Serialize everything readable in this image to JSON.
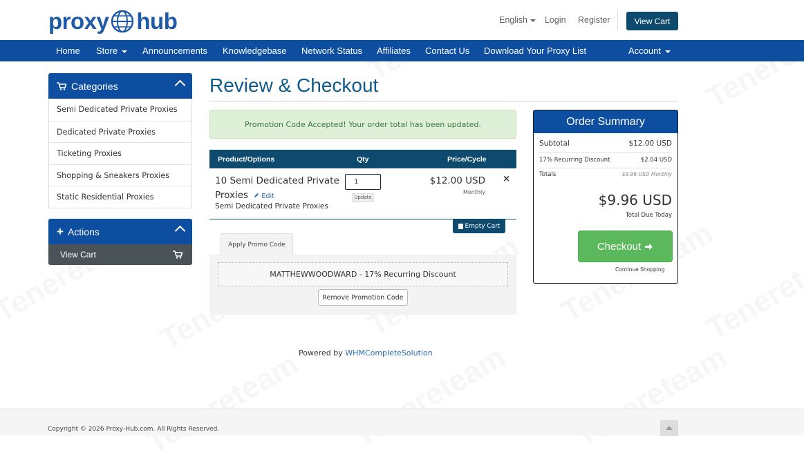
{
  "brand": {
    "logo_left": "proxy",
    "logo_right": "hub"
  },
  "top_links": {
    "language": "English",
    "login": "Login",
    "register": "Register",
    "view_cart": "View Cart"
  },
  "nav": {
    "home": "Home",
    "store": "Store",
    "announcements": "Announcements",
    "knowledgebase": "Knowledgebase",
    "network_status": "Network Status",
    "affiliates": "Affiliates",
    "contact_us": "Contact Us",
    "download": "Download Your Proxy List",
    "account": "Account"
  },
  "sidebar": {
    "categories_title": "Categories",
    "categories": [
      "Semi Dedicated Private Proxies",
      "Dedicated Private Proxies",
      "Ticketing Proxies",
      "Shopping & Sneakers Proxies",
      "Static Residential Proxies"
    ],
    "actions_title": "Actions",
    "actions_view_cart": "View Cart"
  },
  "main": {
    "title": "Review & Checkout",
    "alert": "Promotion Code Accepted! Your order total has been updated.",
    "table_headers": {
      "product": "Product/Options",
      "qty": "Qty",
      "price": "Price/Cycle"
    },
    "item": {
      "name": "10 Semi Dedicated Private Proxies",
      "edit": "Edit",
      "group": "Semi Dedicated Private Proxies",
      "qty": "1",
      "update": "Update",
      "price": "$12.00 USD",
      "cycle": "Monthly",
      "remove": "×"
    },
    "empty_cart": "Empty Cart",
    "promo_tab": "Apply Promo Code",
    "promo_applied": "MATTHEWWOODWARD - 17% Recurring Discount",
    "remove_promo": "Remove Promotion Code"
  },
  "summary": {
    "title": "Order Summary",
    "subtotal_label": "Subtotal",
    "subtotal_value": "$12.00 USD",
    "discount_label": "17% Recurring Discount",
    "discount_value": "$2.04 USD",
    "totals_label": "Totals",
    "totals_value": "$9.96 USD Monthly",
    "total": "$9.96 USD",
    "total_label": "Total Due Today",
    "checkout": "Checkout",
    "continue": "Continue Shopping"
  },
  "powered": {
    "prefix": "Powered by ",
    "link": "WHMCompleteSolution"
  },
  "footer": {
    "copyright": "Copyright © 2026 Proxy-Hub.com. All Rights Reserved."
  },
  "watermark": "Tenereteam",
  "colors": {
    "nav": "#0d4ea0",
    "dark_teal": "#0e4a6e",
    "success": "#5cb85c",
    "alert_bg": "#dff0d8"
  }
}
